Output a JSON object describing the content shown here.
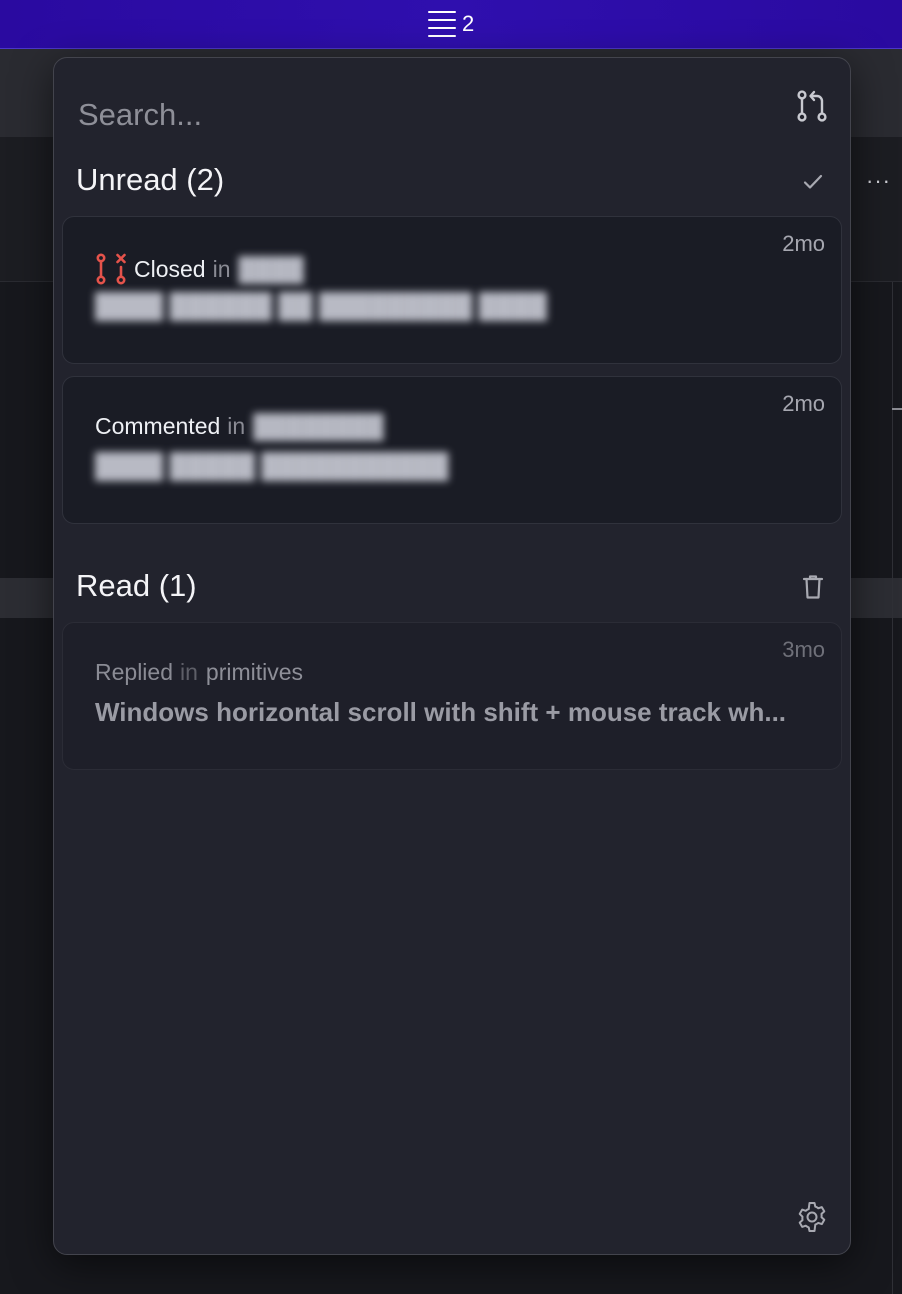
{
  "menubar": {
    "badge_count": "2",
    "icon": "hamburger-icon"
  },
  "popover": {
    "search": {
      "placeholder": "Search...",
      "value": ""
    },
    "header_icons": {
      "pull_request": "pull-request-icon",
      "mark_all_read": "check-icon",
      "clear_read": "trash-icon",
      "settings": "gear-icon"
    },
    "sections": {
      "unread": {
        "title": "Unread (2)",
        "items": [
          {
            "time": "2mo",
            "verb": "Closed",
            "in": "in",
            "repo": "",
            "title": "",
            "icon": "pull-request-closed-icon",
            "icon_color": "#e5534b"
          },
          {
            "time": "2mo",
            "verb": "Commented",
            "in": "in",
            "repo": "",
            "title": ""
          }
        ]
      },
      "read": {
        "title": "Read (1)",
        "items": [
          {
            "time": "3mo",
            "verb": "Replied",
            "in": "in",
            "repo": "primitives",
            "title": "Windows horizontal scroll with shift + mouse track wh..."
          }
        ]
      }
    }
  },
  "colors": {
    "menubar_bg": "#2e0fa8",
    "popover_bg": "#22232d",
    "card_bg": "#1a1c25",
    "accent_red": "#e5534b"
  }
}
